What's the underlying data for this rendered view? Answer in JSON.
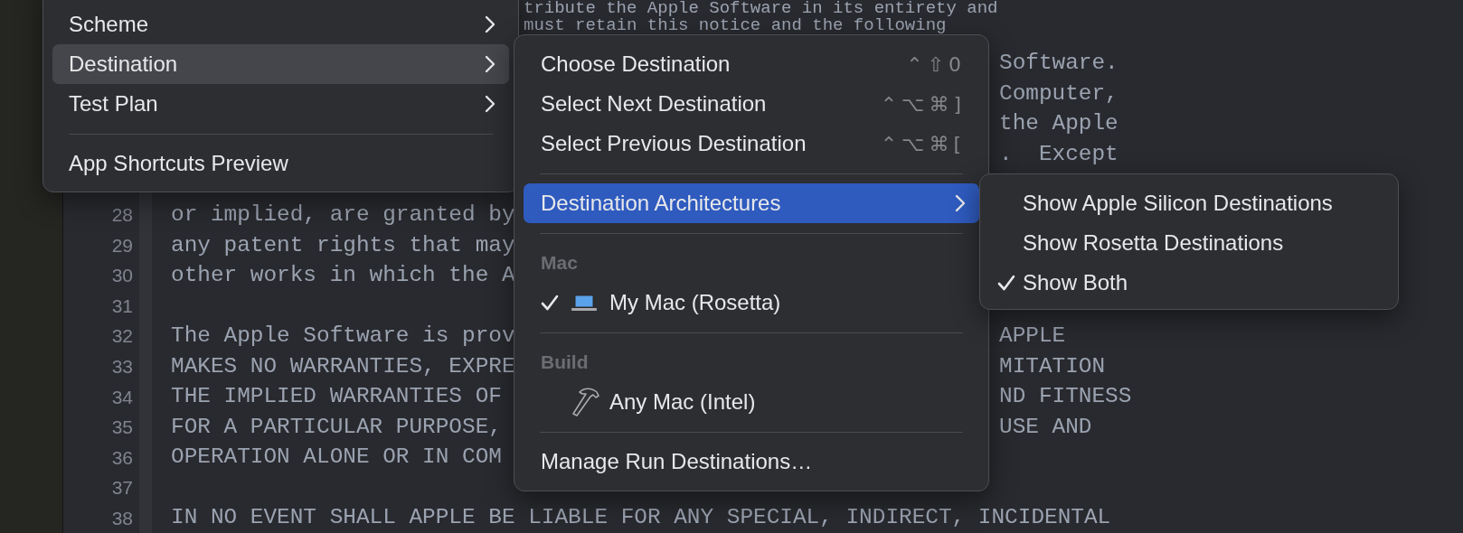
{
  "editor": {
    "top_lines": [
      {
        "text_middle": "tribute the Apple Software in its entirety and"
      },
      {
        "text_middle": "must retain this notice and the following"
      },
      {
        "text_right": "Software."
      },
      {
        "text_right": "Computer,"
      },
      {
        "text_right": "the Apple"
      },
      {
        "text_right": ".  Except"
      }
    ],
    "lines": [
      {
        "number": "28",
        "text": "or implied, are granted by"
      },
      {
        "number": "29",
        "text": "any patent rights that may"
      },
      {
        "number": "30",
        "text": "other works in which the A"
      },
      {
        "number": "31"
      },
      {
        "number": "32",
        "text": "The Apple Software is prov",
        "text_right": "APPLE"
      },
      {
        "number": "33",
        "text": "MAKES NO WARRANTIES, EXPRE",
        "text_right": "MITATION"
      },
      {
        "number": "34",
        "text": "THE IMPLIED WARRANTIES OF",
        "text_right": "ND FITNESS"
      },
      {
        "number": "35",
        "text": "FOR A PARTICULAR PURPOSE,",
        "text_right": "USE AND"
      },
      {
        "number": "36",
        "text": "OPERATION ALONE OR IN COM"
      },
      {
        "number": "37"
      },
      {
        "number": "38",
        "text": "IN NO EVENT SHALL APPLE BE LIABLE FOR ANY SPECIAL, INDIRECT, INCIDENTAL"
      }
    ]
  },
  "menus": [
    {
      "items": [
        {
          "kind": "item",
          "label": "Scheme",
          "submenu": true,
          "selected": false
        },
        {
          "kind": "item",
          "label": "Destination",
          "submenu": true,
          "selected": true
        },
        {
          "kind": "item",
          "label": "Test Plan",
          "submenu": true,
          "selected": false
        },
        {
          "kind": "separator"
        },
        {
          "kind": "item",
          "label": "App Shortcuts Preview",
          "submenu": false,
          "selected": false
        }
      ]
    },
    {
      "items": [
        {
          "kind": "item",
          "label": "Choose Destination",
          "shortcut": "⌃⇧0",
          "submenu": false,
          "selected": false
        },
        {
          "kind": "item",
          "label": "Select Next Destination",
          "shortcut": "⌃⌥⌘]",
          "submenu": false,
          "selected": false
        },
        {
          "kind": "item",
          "label": "Select Previous Destination",
          "shortcut": "⌃⌥⌘[",
          "submenu": false,
          "selected": false
        },
        {
          "kind": "separator"
        },
        {
          "kind": "item",
          "label": "Destination Architectures",
          "submenu": true,
          "selected": true
        },
        {
          "kind": "separator"
        },
        {
          "kind": "header",
          "label": "Mac"
        },
        {
          "kind": "device",
          "label": "My Mac (Rosetta)",
          "checked": true,
          "selected": false
        },
        {
          "kind": "separator"
        },
        {
          "kind": "header",
          "label": "Build"
        },
        {
          "kind": "build",
          "label": "Any Mac (Intel)",
          "checked": false,
          "selected": false
        },
        {
          "kind": "separator"
        },
        {
          "kind": "item",
          "label": "Manage Run Destinations…",
          "submenu": false,
          "selected": false
        }
      ]
    },
    {
      "items": [
        {
          "kind": "option",
          "label": "Show Apple Silicon Destinations",
          "checked": false,
          "selected": false
        },
        {
          "kind": "option",
          "label": "Show Rosetta Destinations",
          "checked": false,
          "selected": false
        },
        {
          "kind": "option",
          "label": "Show Both",
          "checked": true,
          "selected": false
        }
      ]
    }
  ]
}
